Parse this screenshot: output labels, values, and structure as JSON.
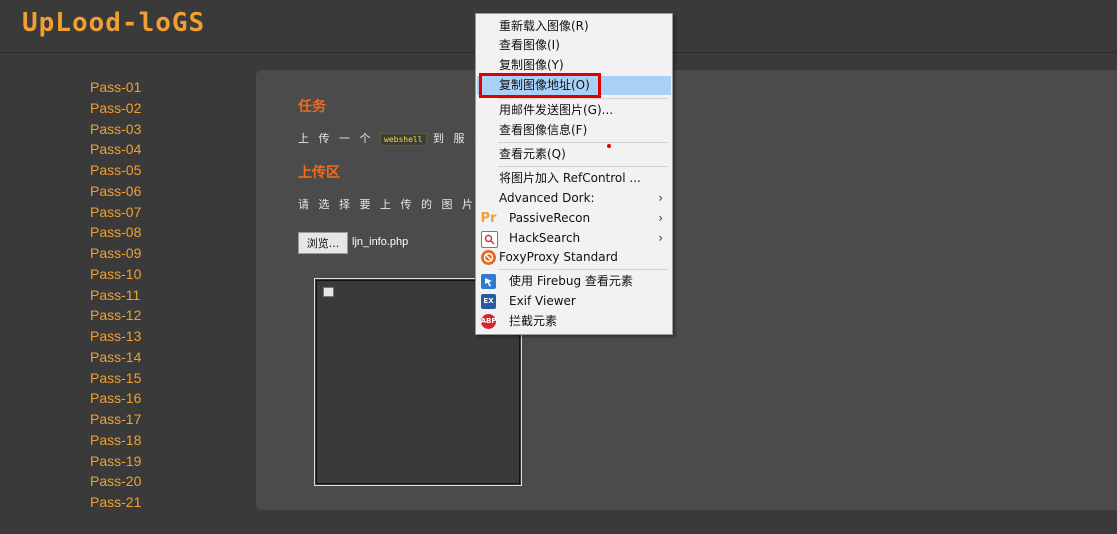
{
  "app": {
    "logo_text": "UpLood-loGS"
  },
  "sidebar": {
    "items": [
      "Pass-01",
      "Pass-02",
      "Pass-03",
      "Pass-04",
      "Pass-05",
      "Pass-06",
      "Pass-07",
      "Pass-08",
      "Pass-09",
      "Pass-10",
      "Pass-11",
      "Pass-12",
      "Pass-13",
      "Pass-14",
      "Pass-15",
      "Pass-16",
      "Pass-17",
      "Pass-18",
      "Pass-19",
      "Pass-20",
      "Pass-21"
    ]
  },
  "main": {
    "task_title": "任务",
    "task_desc_prefix": "上 传 一 个",
    "task_code": "webshell",
    "task_desc_suffix": "到 服 务 器 。",
    "upload_title": "上传区",
    "upload_prompt": "请 选 择 要 上 传 的 图 片 ：",
    "browse_label": "浏览...",
    "file_name": "ljn_info.php"
  },
  "context_menu": {
    "items": [
      {
        "label": "重新载入图像(R)",
        "icon": "",
        "submenu": false
      },
      {
        "label": "查看图像(I)",
        "icon": "",
        "submenu": false
      },
      {
        "label": "复制图像(Y)",
        "icon": "",
        "submenu": false
      },
      {
        "label": "复制图像地址(O)",
        "icon": "",
        "submenu": false,
        "highlighted": true
      },
      {
        "label": "用邮件发送图片(G)...",
        "icon": "",
        "submenu": false
      },
      {
        "label": "查看图像信息(F)",
        "icon": "",
        "submenu": false
      },
      {
        "label": "查看元素(Q)",
        "icon": "",
        "submenu": false
      },
      {
        "label": "将图片加入 RefControl ...",
        "icon": "",
        "submenu": false
      },
      {
        "label": "Advanced Dork:",
        "icon": "",
        "submenu": true
      },
      {
        "label": "PassiveRecon",
        "icon": "passiverecon-icon",
        "submenu": true
      },
      {
        "label": "HackSearch",
        "icon": "hacksearch-icon",
        "submenu": true
      },
      {
        "label": "FoxyProxy Standard",
        "icon": "foxyproxy-icon",
        "submenu": false
      },
      {
        "label": "使用 Firebug 查看元素",
        "icon": "firebug-icon",
        "submenu": false
      },
      {
        "label": "Exif Viewer",
        "icon": "exif-icon",
        "submenu": false
      },
      {
        "label": "拦截元素",
        "icon": "adblock-icon",
        "submenu": false
      }
    ],
    "arrow_glyph": "›",
    "abp_text": "ABP",
    "pr_text": "Pr"
  },
  "colors": {
    "accent": "#f0a030",
    "title": "#f06a1a",
    "highlight": "#a9d1f7",
    "annotation": "#e00000"
  }
}
